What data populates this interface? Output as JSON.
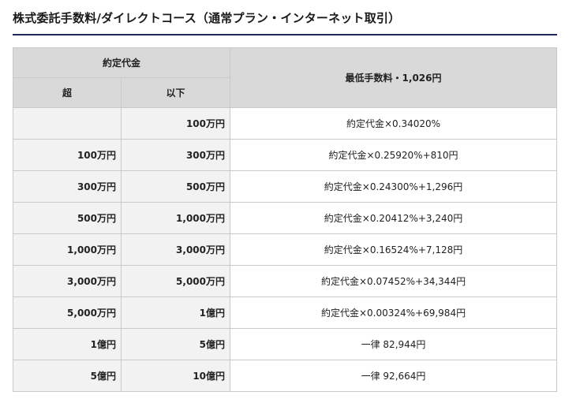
{
  "title": "株式委託手数料/ダイレクトコース（通常プラン・インターネット取引）",
  "table": {
    "header": {
      "trade_amount": "約定代金",
      "over": "超",
      "under": "以下",
      "min_fee": "最低手数料・1,026円"
    },
    "rows": [
      {
        "over": "",
        "under": "100万円",
        "fee": "約定代金×0.34020%"
      },
      {
        "over": "100万円",
        "under": "300万円",
        "fee": "約定代金×0.25920%+810円"
      },
      {
        "over": "300万円",
        "under": "500万円",
        "fee": "約定代金×0.24300%+1,296円"
      },
      {
        "over": "500万円",
        "under": "1,000万円",
        "fee": "約定代金×0.20412%+3,240円"
      },
      {
        "over": "1,000万円",
        "under": "3,000万円",
        "fee": "約定代金×0.16524%+7,128円"
      },
      {
        "over": "3,000万円",
        "under": "5,000万円",
        "fee": "約定代金×0.07452%+34,344円"
      },
      {
        "over": "5,000万円",
        "under": "1億円",
        "fee": "約定代金×0.00324%+69,984円"
      },
      {
        "over": "1億円",
        "under": "5億円",
        "fee": "一律 82,944円"
      },
      {
        "over": "5億円",
        "under": "10億円",
        "fee": "一律 92,664円"
      }
    ]
  },
  "colors": {
    "title_rule": "#1f2a5a",
    "header_bg": "#d9d9d9",
    "range_cell_bg": "#f2f2f2",
    "fee_cell_bg": "#ffffff",
    "border": "#c9c9c9"
  }
}
